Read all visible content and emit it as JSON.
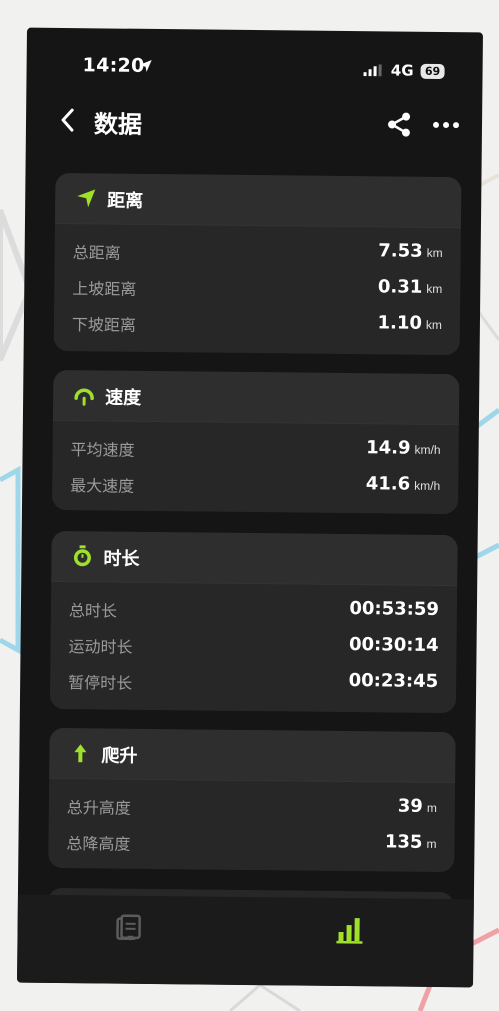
{
  "status_bar": {
    "time": "14:20",
    "network": "4G",
    "battery": "69"
  },
  "header": {
    "title": "数据"
  },
  "sections": {
    "distance": {
      "title": "距离",
      "rows": [
        {
          "label": "总距离",
          "value": "7.53",
          "unit": "km"
        },
        {
          "label": "上坡距离",
          "value": "0.31",
          "unit": "km"
        },
        {
          "label": "下坡距离",
          "value": "1.10",
          "unit": "km"
        }
      ]
    },
    "speed": {
      "title": "速度",
      "rows": [
        {
          "label": "平均速度",
          "value": "14.9",
          "unit": "km/h"
        },
        {
          "label": "最大速度",
          "value": "41.6",
          "unit": "km/h"
        }
      ]
    },
    "duration": {
      "title": "时长",
      "rows": [
        {
          "label": "总时长",
          "value": "00:53:59",
          "unit": ""
        },
        {
          "label": "运动时长",
          "value": "00:30:14",
          "unit": ""
        },
        {
          "label": "暂停时长",
          "value": "00:23:45",
          "unit": ""
        }
      ]
    },
    "climb": {
      "title": "爬升",
      "rows": [
        {
          "label": "总升高度",
          "value": "39",
          "unit": "m"
        },
        {
          "label": "总降高度",
          "value": "135",
          "unit": "m"
        }
      ]
    }
  },
  "icons": {
    "back": "chevron-left-icon",
    "share": "share-icon",
    "more": "more-dots-icon",
    "distance": "navigation-arrow-icon",
    "speed": "speedometer-icon",
    "duration": "stopwatch-icon",
    "climb": "arrow-up-icon",
    "tab_notes": "notes-icon",
    "tab_stats": "bar-chart-icon"
  },
  "colors": {
    "accent": "#9fe02a",
    "card": "#272727",
    "background": "#151515",
    "label": "#9a9a9a"
  }
}
